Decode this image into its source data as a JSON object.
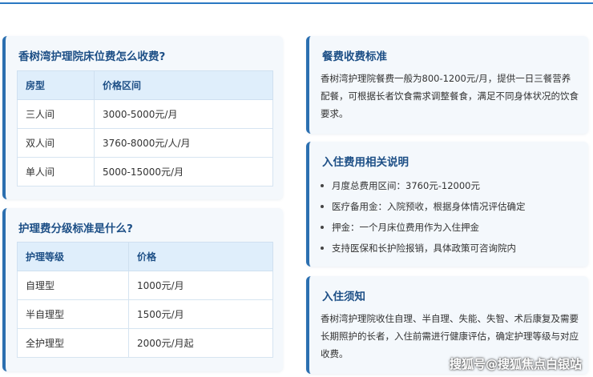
{
  "bed_fee_card": {
    "title": "香树湾护理院床位费怎么收费?",
    "header": [
      "房型",
      "价格区间"
    ],
    "rows": [
      [
        "三人间",
        "3000-5000元/月"
      ],
      [
        "双人间",
        "3760-8000元/人/月"
      ],
      [
        "单人间",
        "5000-15000元/月"
      ]
    ]
  },
  "care_fee_card": {
    "title": "护理费分级标准是什么?",
    "header": [
      "护理等级",
      "价格"
    ],
    "rows": [
      [
        "自理型",
        "1000元/月"
      ],
      [
        "半自理型",
        "1500元/月"
      ],
      [
        "全护理型",
        "2000元/月起"
      ]
    ]
  },
  "meal_card": {
    "title": "餐费收费标准",
    "body": "香树湾护理院餐费一般为800-1200元/月，提供一日三餐营养配餐，可根据长者饮食需求调整餐食，满足不同身体状况的饮食要求。"
  },
  "admission_fee_card": {
    "title": "入住费用相关说明",
    "items": [
      "月度总费用区间：3760元-12000元",
      "医疗备用金：入院预收，根据身体情况评估确定",
      "押金：一个月床位费用作为入住押金",
      "支持医保和长护险报销，具体政策可咨询院内"
    ]
  },
  "notice_card": {
    "title": "入住须知",
    "body": "香树湾护理院收住自理、半自理、失能、失智、术后康复及需要长期照护的长者，入住前需进行健康评估，确定护理等级与对应收费。"
  },
  "watermark": "搜狐号@搜狐焦点白银站",
  "colors": {
    "accent": "#2b6fb0",
    "title": "#1d4f86",
    "card_bg": "#f4f8fc",
    "table_header_bg": "#dfeefb"
  }
}
